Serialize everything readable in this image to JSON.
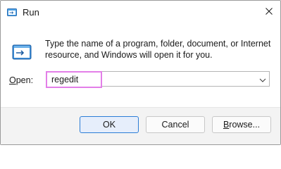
{
  "window": {
    "title": "Run",
    "icon": "run-dialog-icon",
    "close_icon": "close-icon"
  },
  "content": {
    "description_line1": "Type the name of a program, folder, document, or Internet",
    "description_line2": "resource, and Windows will open it for you.",
    "open_label_acc": "O",
    "open_label_rest": "pen:",
    "open_value": "regedit"
  },
  "buttons": {
    "ok": "OK",
    "cancel": "Cancel",
    "browse_acc": "B",
    "browse_rest": "rowse..."
  },
  "colors": {
    "accent": "#2c7dd6",
    "input_highlight": "#e37fe8"
  }
}
